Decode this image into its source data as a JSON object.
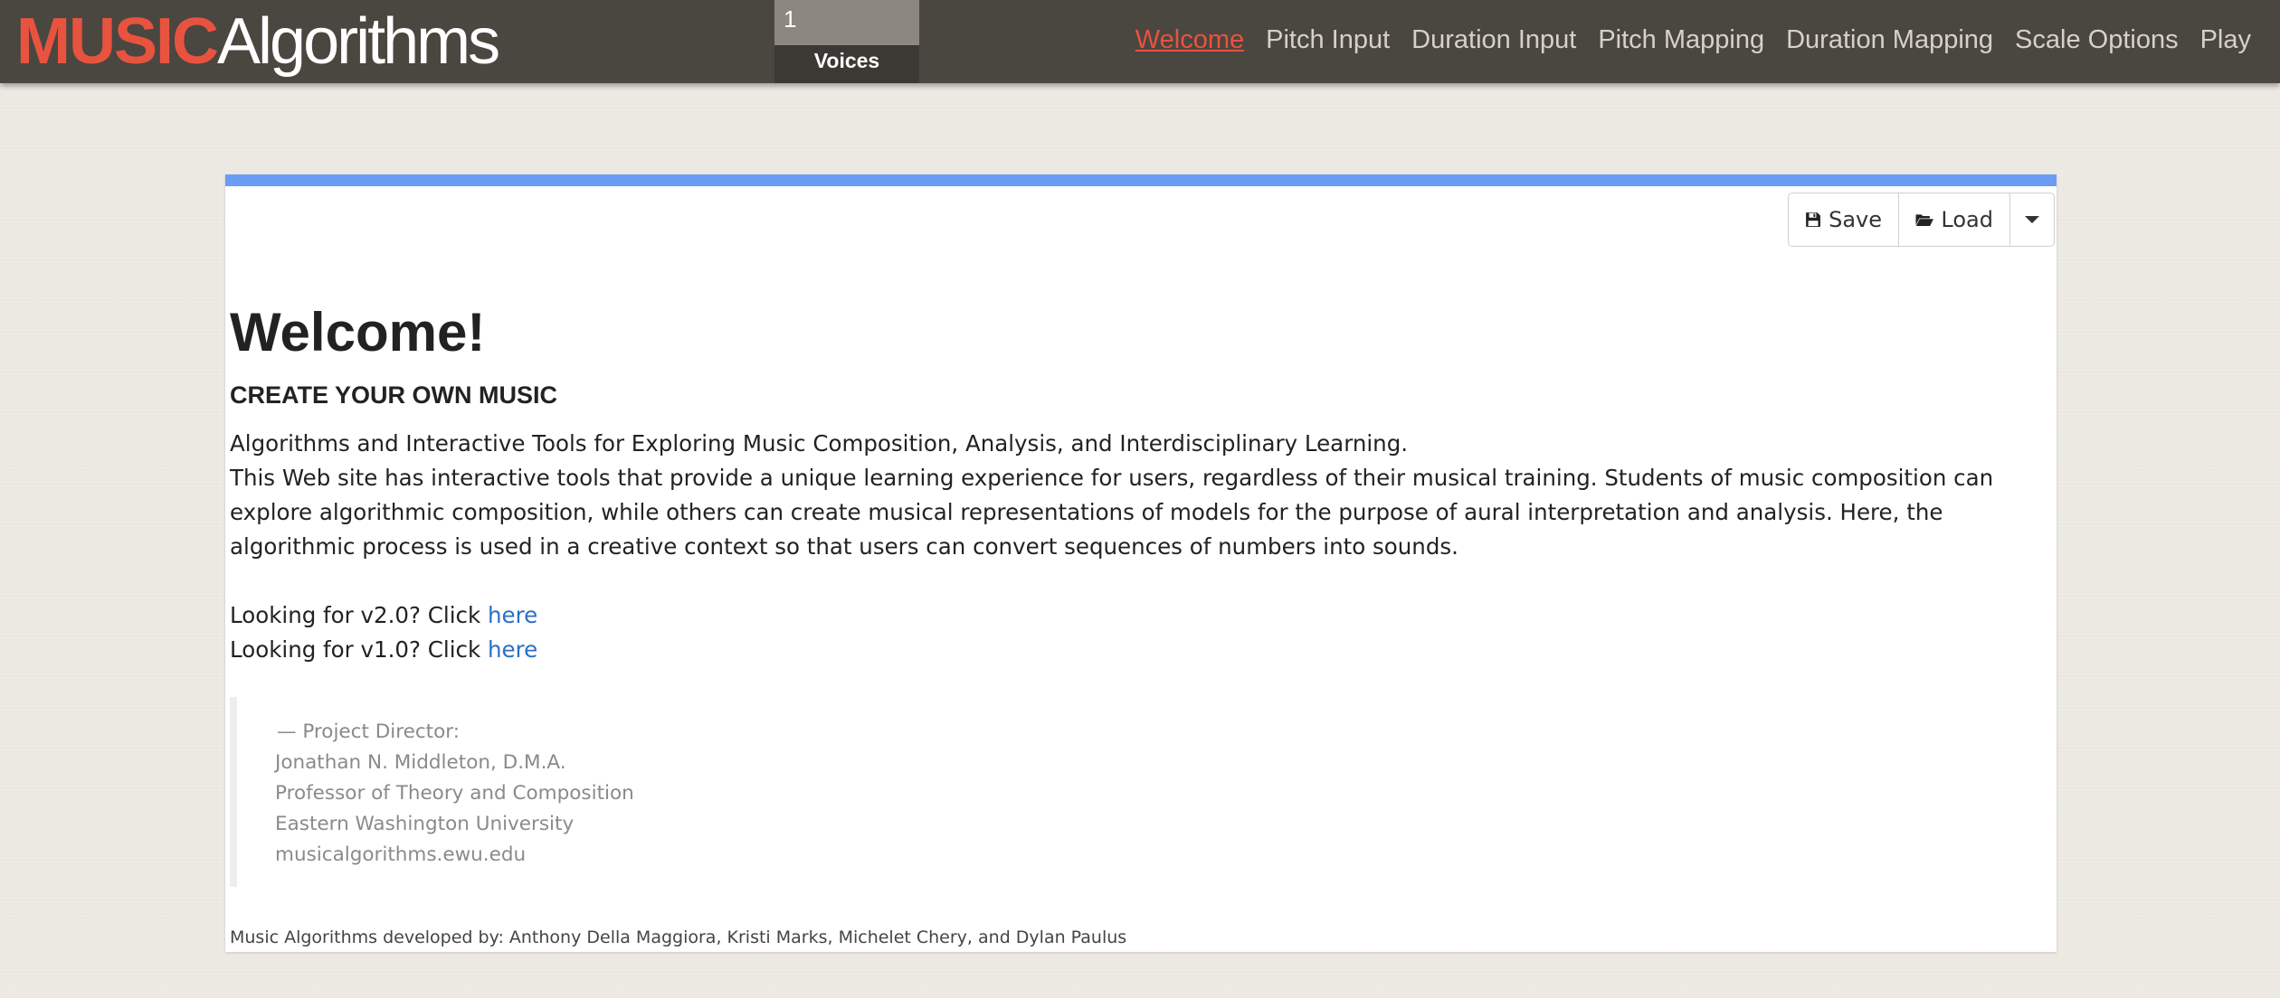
{
  "navbar": {
    "brand_bold": "MUSIC",
    "brand_light": "Algorithms",
    "voices_value": "1",
    "voices_label": "Voices",
    "items": [
      {
        "label": "Welcome",
        "active": true
      },
      {
        "label": "Pitch Input",
        "active": false
      },
      {
        "label": "Duration Input",
        "active": false
      },
      {
        "label": "Pitch Mapping",
        "active": false
      },
      {
        "label": "Duration Mapping",
        "active": false
      },
      {
        "label": "Scale Options",
        "active": false
      },
      {
        "label": "Play",
        "active": false
      }
    ]
  },
  "toolbar": {
    "save_label": "Save",
    "load_label": "Load",
    "save_icon": "floppy-disk-icon",
    "load_icon": "folder-open-icon",
    "dropdown_icon": "caret-down-icon"
  },
  "content": {
    "heading": "Welcome!",
    "subtitle": "CREATE YOUR OWN MUSIC",
    "intro": "Algorithms and Interactive Tools for Exploring Music Composition, Analysis, and Interdisciplinary Learning.",
    "description": "This Web site has interactive tools that provide a unique learning experience for users, regardless of their musical training. Students of music composition can explore algorithmic composition, while others can create musical representations of models for the purpose of aural interpretation and analysis. Here, the algorithmic process is used in a creative context so that users can convert sequences of numbers into sounds.",
    "v2_prefix": "Looking for v2.0? Click ",
    "v2_link": "here",
    "v1_prefix": "Looking for v1.0? Click ",
    "v1_link": "here"
  },
  "credits": {
    "director_label": "—  Project Director:",
    "name": "Jonathan N. Middleton, D.M.A.",
    "title": "Professor of Theory and Composition",
    "university": "Eastern Washington University",
    "website": "musicalgorithms.ewu.edu"
  },
  "footer": {
    "text": "Music Algorithms developed by: Anthony Della Maggiora, Kristi Marks, Michelet Chery, and Dylan Paulus"
  },
  "colors": {
    "navbar_bg": "#4a4640",
    "brand_accent": "#e8533f",
    "panel_top_border": "#6b9cf5",
    "link": "#2b6fc6",
    "page_bg": "#eeebe5"
  }
}
